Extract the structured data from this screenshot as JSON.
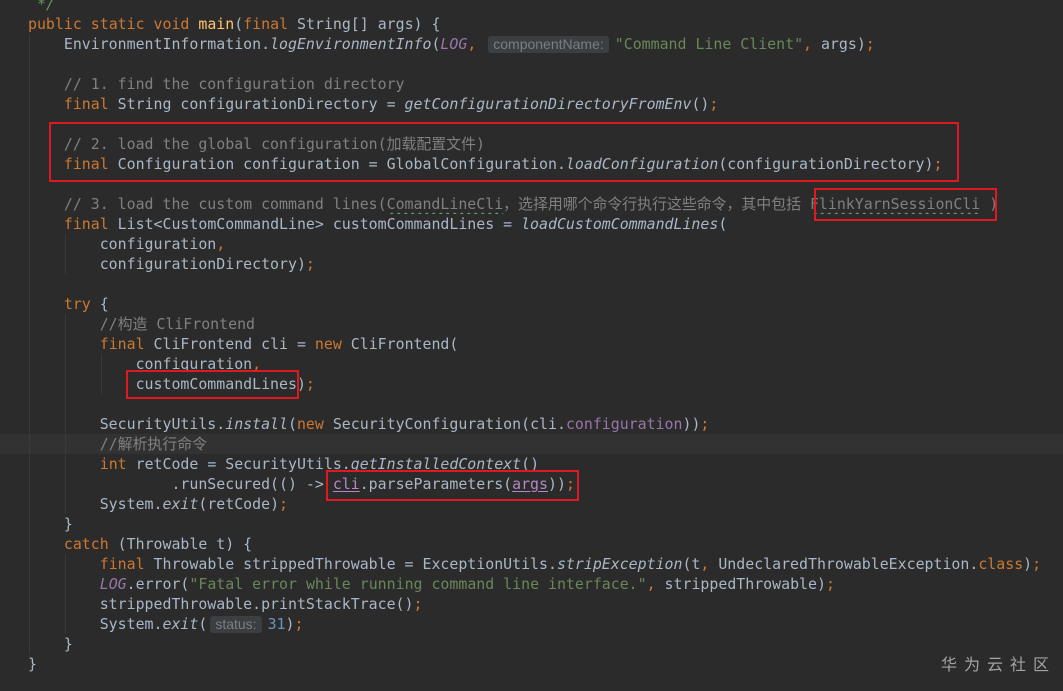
{
  "theme": {
    "editor-bg": "#2b2b2b",
    "current-line-bg": "#323232",
    "default-text": "#a9b7c6",
    "hint-bg": "#3b3f41",
    "hint-text": "#7a7e85",
    "typo-underline": "#659c6b",
    "annotation-border": "#e0181f",
    "watermark-text": "#a3a3a3",
    "indent-guide": "#393939"
  },
  "code": {
    "lines": [
      {
        "tokens": [
          {
            "t": " */",
            "c": "#629755",
            "i": true
          }
        ]
      },
      {
        "tokens": [
          {
            "t": "public",
            "c": "#cc7832"
          },
          {
            "t": " "
          },
          {
            "t": "static",
            "c": "#cc7832"
          },
          {
            "t": " "
          },
          {
            "t": "void",
            "c": "#cc7832"
          },
          {
            "t": " "
          },
          {
            "t": "main",
            "c": "#ffc66d"
          },
          {
            "t": "("
          },
          {
            "t": "final",
            "c": "#cc7832"
          },
          {
            "t": " String[] args) {"
          }
        ]
      },
      {
        "tokens": [
          {
            "t": "    EnvironmentInformation."
          },
          {
            "t": "logEnvironmentInfo",
            "i": true
          },
          {
            "t": "("
          },
          {
            "t": "LOG",
            "c": "#9876aa",
            "i": true
          },
          {
            "t": ",",
            "c": "#cc7832"
          },
          {
            "t": " "
          },
          {
            "t": "componentName:",
            "h": true
          },
          {
            "t": "\"Command Line Client\"",
            "c": "#6a8759"
          },
          {
            "t": ",",
            "c": "#cc7832"
          },
          {
            "t": " args)"
          },
          {
            "t": ";",
            "c": "#cc7832"
          }
        ]
      },
      {
        "tokens": []
      },
      {
        "tokens": [
          {
            "t": "    // 1. find the configuration directory",
            "c": "#808080"
          }
        ]
      },
      {
        "tokens": [
          {
            "t": "    "
          },
          {
            "t": "final",
            "c": "#cc7832"
          },
          {
            "t": " String configurationDirectory = "
          },
          {
            "t": "getConfigurationDirectoryFromEnv",
            "i": true
          },
          {
            "t": "()"
          },
          {
            "t": ";",
            "c": "#cc7832"
          }
        ]
      },
      {
        "tokens": []
      },
      {
        "tokens": [
          {
            "t": "    // 2. load the global configuration(加载配置文件)",
            "c": "#808080"
          }
        ]
      },
      {
        "tokens": [
          {
            "t": "    "
          },
          {
            "t": "final",
            "c": "#cc7832"
          },
          {
            "t": " Configuration configuration = GlobalConfiguration."
          },
          {
            "t": "loadConfiguration",
            "i": true
          },
          {
            "t": "(configurationDirectory)"
          },
          {
            "t": ";",
            "c": "#cc7832"
          }
        ]
      },
      {
        "tokens": []
      },
      {
        "tokens": [
          {
            "t": "    // 3. load the custom command lines(",
            "c": "#808080"
          },
          {
            "t": "ComandLineCli",
            "c": "#808080",
            "w": true
          },
          {
            "t": "，选择用哪个命令行执行这些命令，其中包括 ",
            "c": "#808080"
          },
          {
            "t": "FlinkYarnSessionCli",
            "c": "#808080",
            "w": true
          },
          {
            "t": " )",
            "c": "#808080"
          }
        ]
      },
      {
        "tokens": [
          {
            "t": "    "
          },
          {
            "t": "final",
            "c": "#cc7832"
          },
          {
            "t": " List<CustomCommandLine> customCommandLines = "
          },
          {
            "t": "loadCustomCommandLines",
            "i": true
          },
          {
            "t": "("
          }
        ]
      },
      {
        "tokens": [
          {
            "t": "        configuration"
          },
          {
            "t": ",",
            "c": "#cc7832"
          }
        ]
      },
      {
        "tokens": [
          {
            "t": "        configurationDirectory)"
          },
          {
            "t": ";",
            "c": "#cc7832"
          }
        ]
      },
      {
        "tokens": []
      },
      {
        "tokens": [
          {
            "t": "    "
          },
          {
            "t": "try",
            "c": "#cc7832"
          },
          {
            "t": " {"
          }
        ]
      },
      {
        "tokens": [
          {
            "t": "        //构造 CliFrontend",
            "c": "#808080"
          }
        ]
      },
      {
        "tokens": [
          {
            "t": "        "
          },
          {
            "t": "final",
            "c": "#cc7832"
          },
          {
            "t": " CliFrontend cli = "
          },
          {
            "t": "new",
            "c": "#cc7832"
          },
          {
            "t": " CliFrontend("
          }
        ]
      },
      {
        "tokens": [
          {
            "t": "            configuration"
          },
          {
            "t": ",",
            "c": "#cc7832"
          }
        ]
      },
      {
        "tokens": [
          {
            "t": "            customCommandLines)"
          },
          {
            "t": ";",
            "c": "#cc7832"
          }
        ]
      },
      {
        "tokens": []
      },
      {
        "tokens": [
          {
            "t": "        SecurityUtils."
          },
          {
            "t": "install",
            "i": true
          },
          {
            "t": "("
          },
          {
            "t": "new",
            "c": "#cc7832"
          },
          {
            "t": " SecurityConfiguration(cli."
          },
          {
            "t": "configuration",
            "c": "#9876aa"
          },
          {
            "t": "))"
          },
          {
            "t": ";",
            "c": "#cc7832"
          }
        ]
      },
      {
        "current": true,
        "tokens": [
          {
            "t": "        //解析执行命令",
            "c": "#808080"
          }
        ]
      },
      {
        "tokens": [
          {
            "t": "        "
          },
          {
            "t": "int",
            "c": "#cc7832"
          },
          {
            "t": " retCode = SecurityUtils."
          },
          {
            "t": "getInstalledContext",
            "i": true
          },
          {
            "t": "()"
          }
        ]
      },
      {
        "tokens": [
          {
            "t": "                .runSecured(() -> "
          },
          {
            "t": "cli",
            "c": "#b389c5",
            "u": true
          },
          {
            "t": ".parseParameters("
          },
          {
            "t": "args",
            "c": "#b389c5",
            "u": true
          },
          {
            "t": "))"
          },
          {
            "t": ";",
            "c": "#cc7832"
          }
        ]
      },
      {
        "tokens": [
          {
            "t": "        System."
          },
          {
            "t": "exit",
            "i": true
          },
          {
            "t": "(retCode)"
          },
          {
            "t": ";",
            "c": "#cc7832"
          }
        ]
      },
      {
        "tokens": [
          {
            "t": "    }"
          }
        ]
      },
      {
        "tokens": [
          {
            "t": "    "
          },
          {
            "t": "catch",
            "c": "#cc7832"
          },
          {
            "t": " (Throwable t) {"
          }
        ]
      },
      {
        "tokens": [
          {
            "t": "        "
          },
          {
            "t": "final",
            "c": "#cc7832"
          },
          {
            "t": " Throwable strippedThrowable = ExceptionUtils."
          },
          {
            "t": "stripException",
            "i": true
          },
          {
            "t": "(t"
          },
          {
            "t": ",",
            "c": "#cc7832"
          },
          {
            "t": " UndeclaredThrowableException."
          },
          {
            "t": "class",
            "c": "#cc7832"
          },
          {
            "t": ")"
          },
          {
            "t": ";",
            "c": "#cc7832"
          }
        ]
      },
      {
        "tokens": [
          {
            "t": "        "
          },
          {
            "t": "LOG",
            "c": "#9876aa",
            "i": true
          },
          {
            "t": ".error("
          },
          {
            "t": "\"Fatal error while running command line interface.\"",
            "c": "#6a8759"
          },
          {
            "t": ",",
            "c": "#cc7832"
          },
          {
            "t": " strippedThrowable)"
          },
          {
            "t": ";",
            "c": "#cc7832"
          }
        ]
      },
      {
        "tokens": [
          {
            "t": "        strippedThrowable.printStackTrace()"
          },
          {
            "t": ";",
            "c": "#cc7832"
          }
        ]
      },
      {
        "tokens": [
          {
            "t": "        System."
          },
          {
            "t": "exit",
            "i": true
          },
          {
            "t": "("
          },
          {
            "t": "status:",
            "h": true
          },
          {
            "t": "31",
            "c": "#6897bb"
          },
          {
            "t": ")"
          },
          {
            "t": ";",
            "c": "#cc7832"
          }
        ]
      },
      {
        "tokens": [
          {
            "t": "    }"
          }
        ]
      },
      {
        "tokens": [
          {
            "t": "}"
          }
        ]
      }
    ]
  },
  "watermark": "华为云社区"
}
